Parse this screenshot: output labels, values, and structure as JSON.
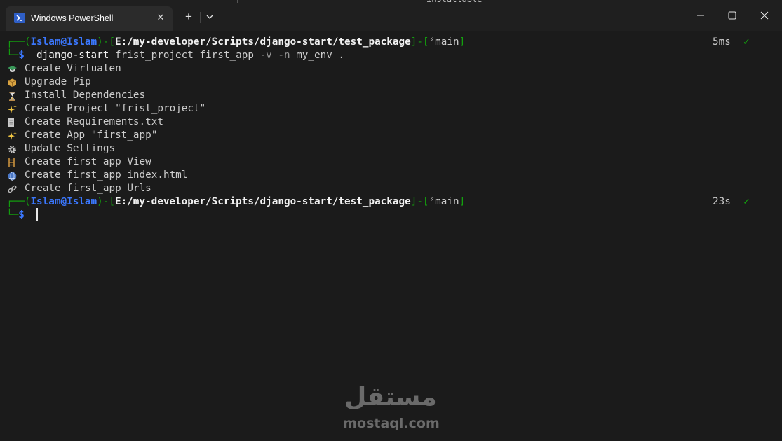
{
  "window": {
    "tab_title": "Windows PowerShell",
    "background_fragment": "installable"
  },
  "prompt": {
    "user": "Islam@Islam",
    "path": "E:/my-developer/Scripts/django-start/test_package",
    "branch": "main",
    "symbol": "$"
  },
  "command": {
    "name": "django-start",
    "args": "frist_project first_app",
    "flag_v": "-v",
    "flag_n": "-n",
    "env": "my_env",
    "dot": "."
  },
  "first_prompt_time": "5ms",
  "second_prompt_time": "23s",
  "status_check": "✓",
  "output_lines": [
    {
      "icon": "graduation-cap-icon",
      "text": "Create Virtualen"
    },
    {
      "icon": "package-icon",
      "text": "Upgrade Pip"
    },
    {
      "icon": "hourglass-icon",
      "text": "Install Dependencies"
    },
    {
      "icon": "sparkles-icon",
      "text": "Create Project \"frist_project\""
    },
    {
      "icon": "document-icon",
      "text": "Create Requirements.txt"
    },
    {
      "icon": "sparkles-icon",
      "text": "Create App \"first_app\""
    },
    {
      "icon": "gear-icon",
      "text": "Update Settings"
    },
    {
      "icon": "ladder-icon",
      "text": "Create first_app View"
    },
    {
      "icon": "globe-icon",
      "text": "Create first_app index.html"
    },
    {
      "icon": "link-icon",
      "text": "Create first_app Urls"
    }
  ],
  "watermark": {
    "arabic": "مستقل",
    "latin": "mostaql.com"
  },
  "colors": {
    "background": "#1b1b1b",
    "prompt_green": "#13a10e",
    "user_blue": "#3b78ff",
    "text": "#cccccc"
  }
}
